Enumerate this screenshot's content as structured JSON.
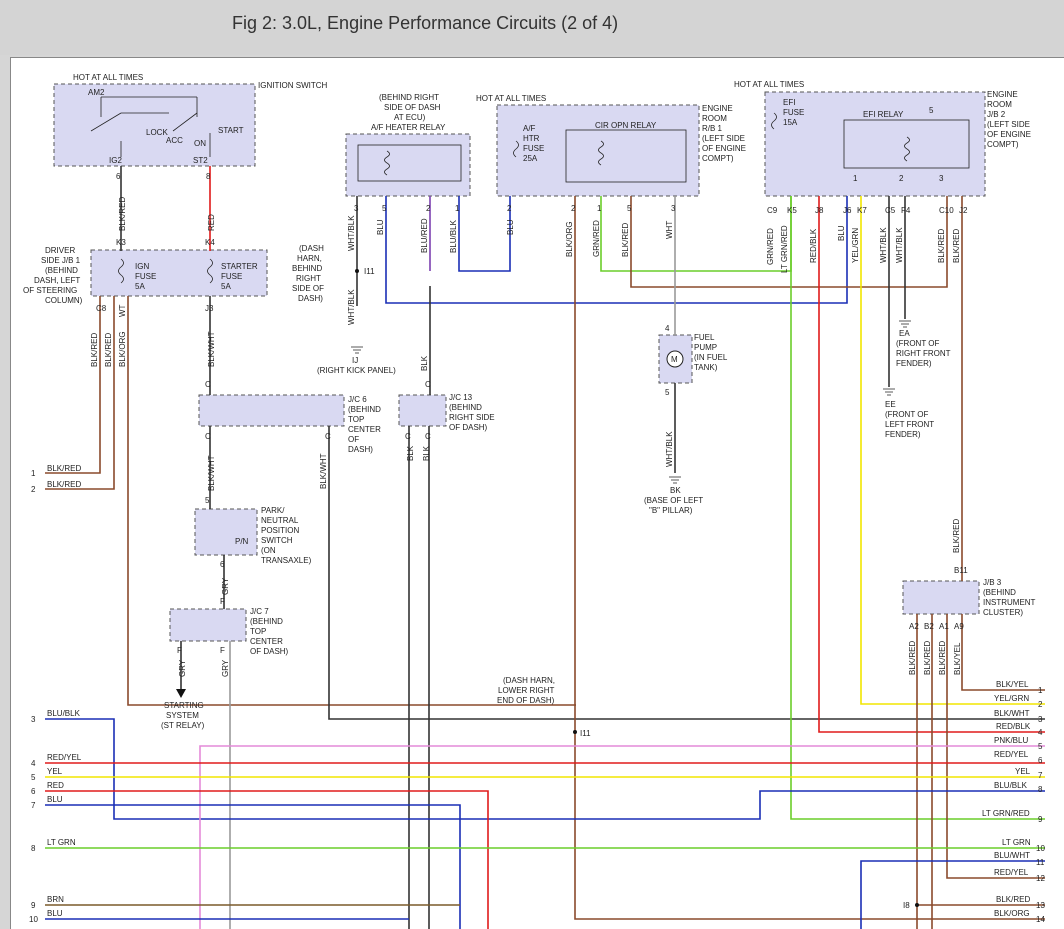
{
  "title": "Fig 2: 3.0L, Engine Performance Circuits (2 of 4)",
  "colors": {
    "blue": "#1a2fb5",
    "red": "#e01b1b",
    "yellow": "#f2e600",
    "green": "#6acd2a",
    "pink": "#e48ad8",
    "brown": "#8a4a2c",
    "gray": "#999999",
    "black": "#333333",
    "olive": "#7a5a2a",
    "box_fill": "#d9d9f2"
  },
  "components": {
    "ign_switch": {
      "title": "IGNITION SWITCH",
      "hot": "HOT AT ALL TIMES",
      "am2": "AM2",
      "lock": "LOCK",
      "acc": "ACC",
      "on": "ON",
      "start": "START",
      "ig2": "IG2",
      "st2": "ST2",
      "pin_ig2": "6",
      "pin_st2": "8"
    },
    "jb1": {
      "title_1": "DRIVER",
      "title_2": "SIDE J/B 1",
      "title_3": "(BEHIND",
      "title_4": "DASH, LEFT",
      "title_5": "OF STEERING",
      "title_6": "COLUMN)",
      "ign_fuse_1": "IGN",
      "ign_fuse_2": "FUSE",
      "ign_fuse_3": "5A",
      "st_fuse_1": "STARTER",
      "st_fuse_2": "FUSE",
      "st_fuse_3": "5A",
      "pin_k3": "K3",
      "pin_k4": "K4",
      "pin_c8": "C8",
      "pin_j3": "J3"
    },
    "af_relay": {
      "line1": "(BEHIND RIGHT",
      "line2": "SIDE OF DASH",
      "line3": "AT ECU)",
      "line4": "A/F HEATER RELAY",
      "p3": "3",
      "p5": "5",
      "p2": "2",
      "p1": "1"
    },
    "rb1": {
      "hot": "HOT AT ALL TIMES",
      "fuse1": "A/F",
      "fuse2": "HTR",
      "fuse3": "FUSE",
      "fuse4": "25A",
      "relay": "CIR OPN RELAY",
      "title1": "ENGINE",
      "title2": "ROOM",
      "title3": "R/B 1",
      "title4": "(LEFT SIDE",
      "title5": "OF ENGINE",
      "title6": "COMPT)",
      "p2": "2",
      "p2b": "2",
      "p1": "1",
      "p5": "5",
      "p3": "3"
    },
    "jb2": {
      "hot": "HOT AT ALL TIMES",
      "efi1": "EFI",
      "efi2": "FUSE",
      "efi3": "15A",
      "relay": "EFI RELAY",
      "title1": "ENGINE",
      "title2": "ROOM",
      "title3": "J/B 2",
      "title4": "(LEFT SIDE",
      "title5": "OF ENGINE",
      "title6": "COMPT)",
      "p1": "1",
      "p2": "2",
      "p3": "3",
      "p5": "5",
      "c9": "C9",
      "k5": "K5",
      "j8": "J8",
      "j6": "J6",
      "k7": "K7",
      "c5": "C5",
      "f4": "F4",
      "c10": "C10",
      "j2": "J2"
    },
    "jc6": {
      "l1": "J/C 6",
      "l2": "(BEHIND",
      "l3": "TOP",
      "l4": "CENTER",
      "l5": "OF",
      "l6": "DASH)",
      "c": "C"
    },
    "jc13": {
      "l1": "J/C 13",
      "l2": "(BEHIND",
      "l3": "RIGHT SIDE",
      "l4": "OF DASH)",
      "c": "C"
    },
    "pn_switch": {
      "l1": "PARK/",
      "l2": "NEUTRAL",
      "l3": "POSITION",
      "l4": "SWITCH",
      "l5": "(ON",
      "l6": "TRANSAXLE)",
      "pn": "P/N",
      "p5": "5",
      "p6": "6"
    },
    "jc7": {
      "l1": "J/C 7",
      "l2": "(BEHIND",
      "l3": "TOP",
      "l4": "CENTER",
      "l5": "OF DASH)",
      "f": "F"
    },
    "fuel_pump": {
      "l1": "FUEL",
      "l2": "PUMP",
      "l3": "(IN FUEL",
      "l4": "TANK)",
      "m": "M",
      "p4": "4",
      "p5": "5"
    },
    "jb3": {
      "l1": "J/B 3",
      "l2": "(BEHIND",
      "l3": "INSTRUMENT",
      "l4": "CLUSTER)",
      "b11": "B11",
      "a2": "A2",
      "b2": "B2",
      "a1": "A1",
      "a9": "A9"
    },
    "dash_harn": {
      "l1": "(DASH",
      "l2": "HARN,",
      "l3": "BEHIND",
      "l4": "RIGHT",
      "l5": "SIDE OF",
      "l6": "DASH)",
      "i11": "I11"
    },
    "dash_harn2": {
      "l1": "(DASH HARN,",
      "l2": "LOWER RIGHT",
      "l3": "END OF DASH)",
      "i11": "I11"
    },
    "grounds": {
      "ij": "IJ",
      "ij_desc": "(RIGHT KICK PANEL)",
      "bk": "BK",
      "bk1": "(BASE OF LEFT",
      "bk2": "\"B\" PILLAR)",
      "ea": "EA",
      "ea1": "(FRONT OF",
      "ea2": "RIGHT FRONT",
      "ea3": "FENDER)",
      "ee": "EE",
      "ee1": "(FRONT OF",
      "ee2": "LEFT FRONT",
      "ee3": "FENDER)"
    },
    "starting": {
      "l1": "STARTING",
      "l2": "SYSTEM",
      "l3": "(ST RELAY)"
    },
    "i8": "I8"
  },
  "wire_labels": {
    "blk_red": "BLK/RED",
    "red": "RED",
    "blk_org": "BLK/ORG",
    "wt": "WT",
    "blk_wht": "BLK/WHT",
    "gry": "GRY",
    "wht_blk": "WHT/BLK",
    "blu": "BLU",
    "blu_red": "BLU/RED",
    "blu_blk": "BLU/BLK",
    "grn_red": "GRN/RED",
    "wht": "WHT",
    "blk": "BLK",
    "lt_grn_red": "LT GRN/RED",
    "red_blk": "RED/BLK",
    "yel_grn": "YEL/GRN",
    "blk_yel": "BLK/YEL"
  },
  "left_pins": [
    {
      "n": "1",
      "label": "BLK/RED"
    },
    {
      "n": "2",
      "label": "BLK/RED"
    },
    {
      "n": "3",
      "label": "BLU/BLK"
    },
    {
      "n": "4",
      "label": "RED/YEL"
    },
    {
      "n": "5",
      "label": "YEL"
    },
    {
      "n": "6",
      "label": "RED"
    },
    {
      "n": "7",
      "label": "BLU"
    },
    {
      "n": "8",
      "label": "LT GRN"
    },
    {
      "n": "9",
      "label": "BRN"
    },
    {
      "n": "10",
      "label": "BLU"
    }
  ],
  "right_pins": [
    {
      "n": "1",
      "label": "BLK/YEL"
    },
    {
      "n": "2",
      "label": "YEL/GRN"
    },
    {
      "n": "3",
      "label": "BLK/WHT"
    },
    {
      "n": "4",
      "label": "RED/BLK"
    },
    {
      "n": "5",
      "label": "PNK/BLU"
    },
    {
      "n": "6",
      "label": "RED/YEL"
    },
    {
      "n": "7",
      "label": "YEL"
    },
    {
      "n": "8",
      "label": "BLU/BLK"
    },
    {
      "n": "9",
      "label": "LT GRN/RED"
    },
    {
      "n": "10",
      "label": "LT GRN"
    },
    {
      "n": "11",
      "label": "BLU/WHT"
    },
    {
      "n": "12",
      "label": "RED/YEL"
    },
    {
      "n": "13",
      "label": "BLK/RED"
    },
    {
      "n": "14",
      "label": "BLK/ORG"
    }
  ]
}
